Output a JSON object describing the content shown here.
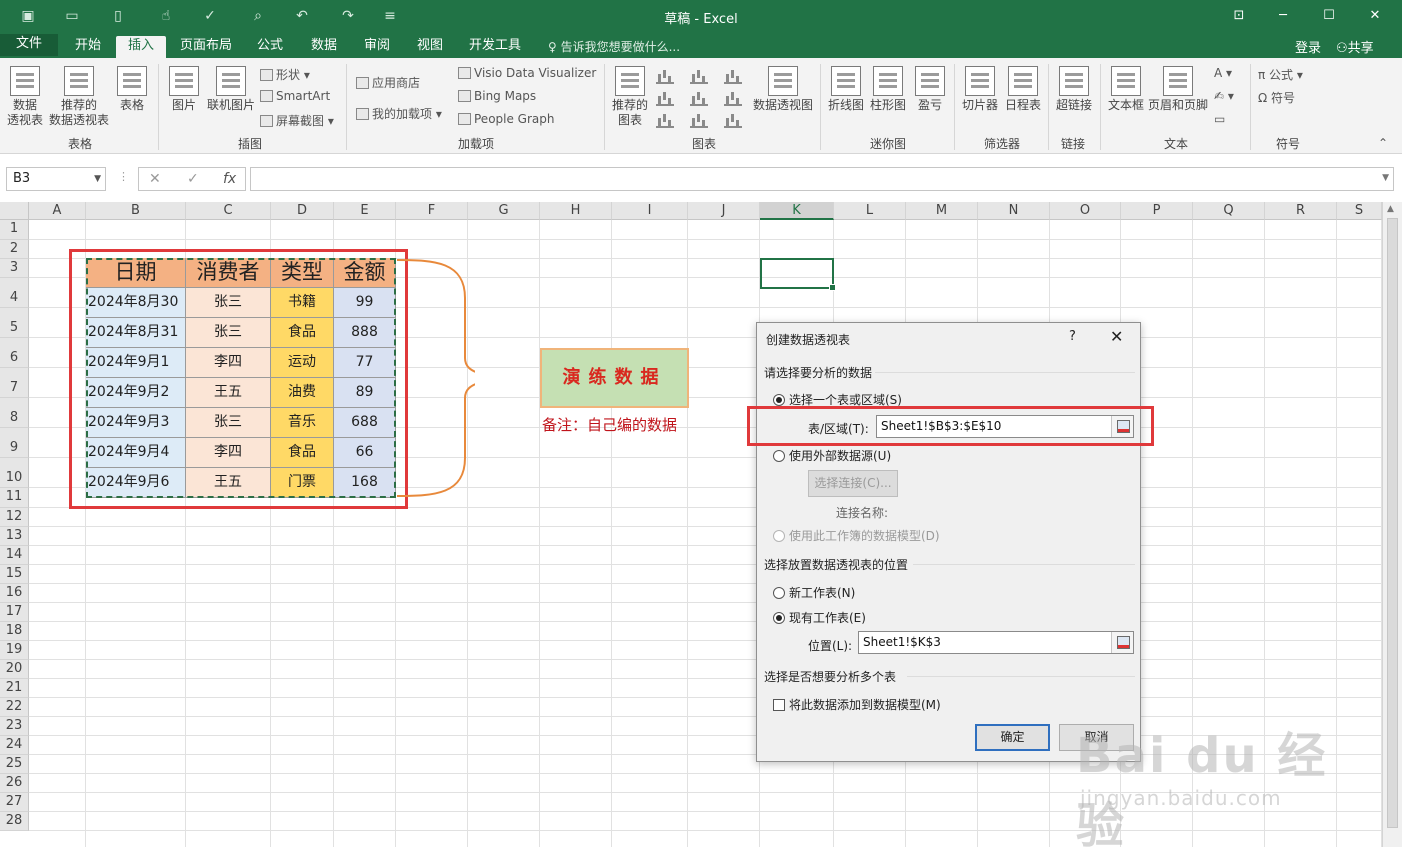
{
  "title": "草稿 - Excel",
  "tabs": [
    {
      "label": "文件"
    },
    {
      "label": "开始"
    },
    {
      "label": "插入"
    },
    {
      "label": "页面布局"
    },
    {
      "label": "公式"
    },
    {
      "label": "数据"
    },
    {
      "label": "审阅"
    },
    {
      "label": "视图"
    },
    {
      "label": "开发工具"
    }
  ],
  "tell_me": "告诉我您想要做什么...",
  "login": "登录",
  "share": "共享",
  "ribbon": {
    "pivot_table": "数据\n透视表",
    "recommended_pivot": "推荐的\n数据透视表",
    "table": "表格",
    "picture": "图片",
    "online_picture": "联机图片",
    "shapes": "形状",
    "smartart": "SmartArt",
    "screenshot": "屏幕截图",
    "store": "应用商店",
    "my_addins": "我的加载项",
    "visio": "Visio Data Visualizer",
    "bing_maps": "Bing Maps",
    "people_graph": "People Graph",
    "recommended_charts": "推荐的\n图表",
    "pivot_chart": "数据透视图",
    "line": "折线图",
    "column": "柱形图",
    "winloss": "盈亏",
    "slicer": "切片器",
    "timeline": "日程表",
    "hyperlink": "超链接",
    "textbox": "文本框",
    "header_footer": "页眉和页脚",
    "equation": "公式",
    "symbol": "符号",
    "groups": {
      "tables": "表格",
      "illustrations": "插图",
      "addins": "加载项",
      "charts": "图表",
      "sparklines": "迷你图",
      "filters": "筛选器",
      "links": "链接",
      "text": "文本",
      "symbols": "符号"
    }
  },
  "name_box": "B3",
  "columns": [
    "A",
    "B",
    "C",
    "D",
    "E",
    "F",
    "G",
    "H",
    "I",
    "J",
    "K",
    "L",
    "M",
    "N",
    "O",
    "P",
    "Q",
    "R",
    "S"
  ],
  "rows": [
    "1",
    "2",
    "3",
    "4",
    "5",
    "6",
    "7",
    "8",
    "9",
    "10",
    "11",
    "12",
    "13",
    "14",
    "15",
    "16",
    "17",
    "18",
    "19",
    "20",
    "21",
    "22",
    "23",
    "24",
    "25",
    "26",
    "27",
    "28"
  ],
  "table": {
    "headers": [
      "日期",
      "消费者",
      "类型",
      "金额"
    ],
    "rows": [
      [
        "2024年8月30",
        "张三",
        "书籍",
        "99"
      ],
      [
        "2024年8月31",
        "张三",
        "食品",
        "888"
      ],
      [
        "2024年9月1",
        "李四",
        "运动",
        "77"
      ],
      [
        "2024年9月2",
        "王五",
        "油费",
        "89"
      ],
      [
        "2024年9月3",
        "张三",
        "音乐",
        "688"
      ],
      [
        "2024年9月4",
        "李四",
        "食品",
        "66"
      ],
      [
        "2024年9月6",
        "王五",
        "门票",
        "168"
      ]
    ]
  },
  "colors": {
    "header_fill": "#f4b183",
    "col_b_fill": "#ddebf7",
    "col_c_fill": "#fbe5d6",
    "col_d_fill": "#ffd966",
    "col_e_fill": "#d9e1f2"
  },
  "demo_box": "演练数据",
  "note": "备注：自己编的数据",
  "dialog": {
    "title": "创建数据透视表",
    "help": "?",
    "close": "✕",
    "section1": "请选择要分析的数据",
    "opt_range": "选择一个表或区域(S)",
    "range_label": "表/区域(T):",
    "range_value": "Sheet1!$B$3:$E$10",
    "opt_external": "使用外部数据源(U)",
    "choose_conn": "选择连接(C)...",
    "conn_name": "连接名称:",
    "opt_model": "使用此工作簿的数据模型(D)",
    "section2": "选择放置数据透视表的位置",
    "opt_new": "新工作表(N)",
    "opt_existing": "现有工作表(E)",
    "loc_label": "位置(L):",
    "loc_value": "Sheet1!$K$3",
    "section3": "选择是否想要分析多个表",
    "add_model": "将此数据添加到数据模型(M)",
    "ok": "确定",
    "cancel": "取消"
  },
  "watermark": {
    "brand": "Bai du 经验",
    "url": "jingyan.baidu.com"
  }
}
